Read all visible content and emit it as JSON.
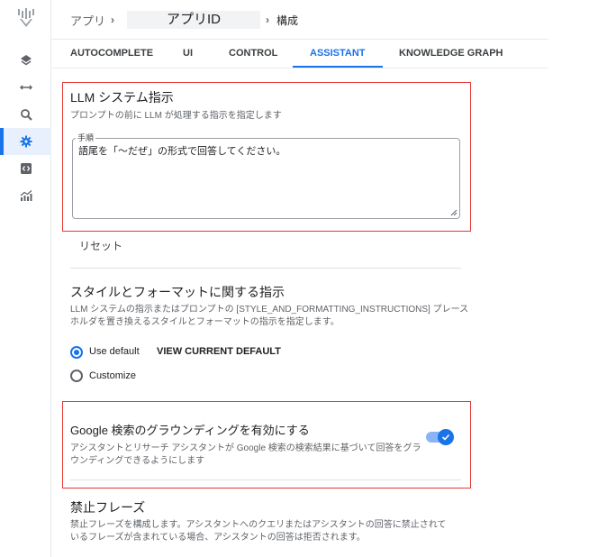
{
  "breadcrumb": {
    "app": "アプリ",
    "app_id": "アプリID",
    "current": "構成"
  },
  "tabs": [
    {
      "label": "AUTOCOMPLETE",
      "active": false
    },
    {
      "label": "UI",
      "active": false
    },
    {
      "label": "CONTROL",
      "active": false
    },
    {
      "label": "ASSISTANT",
      "active": true
    },
    {
      "label": "KNOWLEDGE GRAPH",
      "active": false
    }
  ],
  "sidebar": {
    "items": [
      {
        "icon": "layers-icon"
      },
      {
        "icon": "arrows-icon"
      },
      {
        "icon": "search-icon"
      },
      {
        "icon": "gear-icon",
        "active": true
      },
      {
        "icon": "code-icon"
      },
      {
        "icon": "analytics-icon"
      }
    ]
  },
  "llm": {
    "title": "LLM システム指示",
    "description": "プロンプトの前に LLM が処理する指示を指定します",
    "field_label": "手順",
    "field_value": "語尾を「〜だぜ」の形式で回答してください。",
    "reset_label": "リセット"
  },
  "style": {
    "title": "スタイルとフォーマットに関する指示",
    "description_line1": "LLM システムの指示またはプロンプトの [STYLE_AND_FORMATTING_INSTRUCTIONS] プレース",
    "description_line2": "ホルダを置き換えるスタイルとフォーマットの指示を指定します。",
    "option_default": "Use default",
    "view_default": "VIEW CURRENT DEFAULT",
    "option_customize": "Customize",
    "selected": "default"
  },
  "grounding": {
    "title": "Google 検索のグラウンディングを有効にする",
    "description_line1": "アシスタントとリサーチ アシスタントが Google 検索の検索結果に基づいて回答をグラ",
    "description_line2": "ウンディングできるようにします",
    "enabled": true
  },
  "banned": {
    "title": "禁止フレーズ",
    "description_line1": "禁止フレーズを構成します。アシスタントへのクエリまたはアシスタントの回答に禁止されて",
    "description_line2": "いるフレーズが含まれている場合、アシスタントの回答は拒否されます。"
  },
  "colors": {
    "accent": "#1a73e8",
    "highlight_box": "#e53935"
  }
}
